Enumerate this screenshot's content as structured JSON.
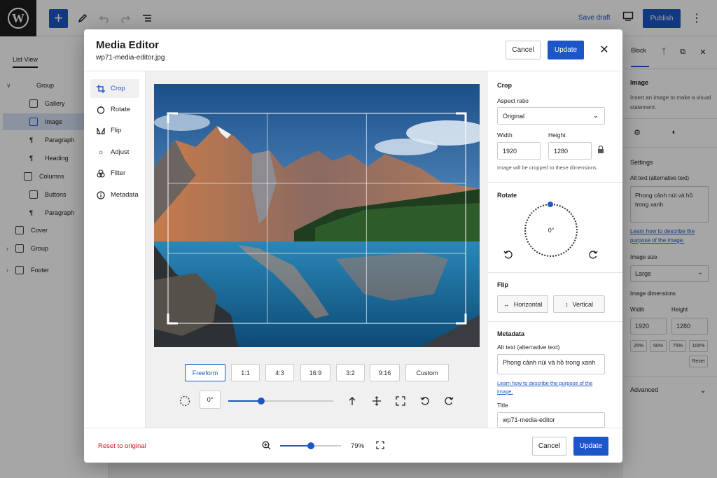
{
  "topbar": {
    "logo_letter": "W",
    "add_symbol": "+",
    "save_draft": "Save draft",
    "publish": "Publish",
    "more_symbol": "⋮"
  },
  "list_view": {
    "title": "List View",
    "items": [
      {
        "label": "Group",
        "icon": "caret-down-icon"
      },
      {
        "label": "Gallery",
        "icon": "gallery-icon"
      },
      {
        "label": "Image",
        "icon": "image-icon",
        "selected": true
      },
      {
        "label": "Paragraph",
        "icon": "paragraph-icon"
      },
      {
        "label": "Heading",
        "icon": "heading-icon"
      },
      {
        "label": "Columns",
        "icon": "columns-icon"
      },
      {
        "label": "Buttons",
        "icon": "buttons-icon"
      },
      {
        "label": "Paragraph",
        "icon": "paragraph-icon"
      },
      {
        "label": "Cover",
        "icon": "cover-icon"
      },
      {
        "label": "Group",
        "icon": "group-icon"
      },
      {
        "label": "Footer",
        "icon": "footer-icon"
      }
    ]
  },
  "sidebar": {
    "tab_block": "Block",
    "block_name": "Image",
    "block_desc": "Insert an image to make a visual statement.",
    "settings_title": "Settings",
    "alt_label": "Alt text (alternative text)",
    "alt_value": "Phong cảnh núi và hồ trong xanh",
    "alt_link": "Learn how to describe the purpose of the image.",
    "size_label": "Image size",
    "size_value": "Large",
    "dims_label": "Image dimensions",
    "width_label": "Width",
    "height_label": "Height",
    "width_value": "1920",
    "height_value": "1280",
    "pct": [
      "25%",
      "50%",
      "75%",
      "100%"
    ],
    "reset": "Reset",
    "advanced": "Advanced"
  },
  "modal": {
    "title": "Media Editor",
    "filename": "wp71-media-editor.jpg",
    "cancel": "Cancel",
    "update": "Update",
    "close_symbol": "✕",
    "tools": [
      {
        "label": "Crop",
        "icon": "crop-icon",
        "active": true
      },
      {
        "label": "Rotate",
        "icon": "rotate-icon"
      },
      {
        "label": "Flip",
        "icon": "flip-icon"
      },
      {
        "label": "Adjust",
        "icon": "adjust-icon"
      },
      {
        "label": "Filter",
        "icon": "filter-icon"
      },
      {
        "label": "Metadata",
        "icon": "info-icon"
      }
    ],
    "aspect_buttons": [
      "Freeform",
      "1:1",
      "4:3",
      "16:9",
      "3:2",
      "9:16",
      "Custom"
    ],
    "aspect_active": "Freeform",
    "rotation_value": "0°",
    "rotation_slider_fraction": 0.31,
    "crop_panel": {
      "title": "Crop",
      "aspect_label": "Aspect ratio",
      "aspect_value": "Original",
      "width_label": "Width",
      "height_label": "Height",
      "width_value": "1920",
      "height_value": "1280",
      "note": "Image will be cropped to these dimensions."
    },
    "rotate_panel": {
      "title": "Rotate",
      "value": "0°"
    },
    "flip_panel": {
      "title": "Flip",
      "horizontal": "Horizontal",
      "vertical": "Vertical"
    },
    "metadata_panel": {
      "title": "Metadata",
      "alt_label": "Alt text (alternative text)",
      "alt_value": "Phong cảnh núi và hồ trong xanh",
      "alt_link": "Learn how to describe the purpose of the image.",
      "title_label": "Title",
      "title_value": "wp71-media-editor"
    },
    "footer": {
      "reset": "Reset to original",
      "zoom_value": "79%",
      "zoom_fraction": 0.5,
      "cancel": "Cancel",
      "update": "Update"
    }
  }
}
